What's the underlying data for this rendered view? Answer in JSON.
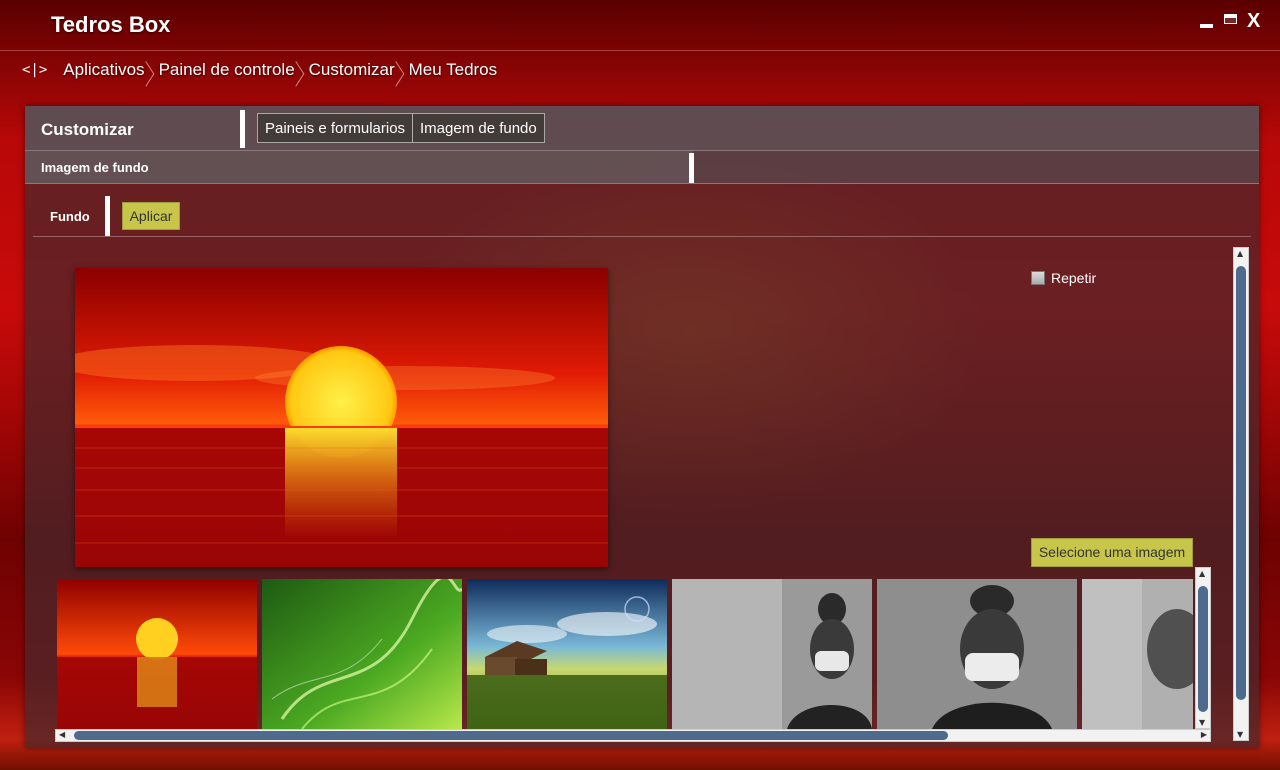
{
  "window": {
    "title": "Tedros Box",
    "controls": {
      "minimize_icon": "minimize-icon",
      "maximize_icon": "maximize-icon",
      "close_label": "X"
    }
  },
  "breadcrumb": {
    "back_label": "<|>",
    "items": [
      "Aplicativos",
      "Painel de controle",
      "Customizar",
      "Meu Tedros"
    ]
  },
  "panel": {
    "title": "Customizar",
    "tabs": [
      "Paineis e formularios",
      "Imagem de fundo"
    ],
    "subtitle": "Imagem de fundo"
  },
  "form": {
    "section_label": "Fundo",
    "apply_label": "Aplicar",
    "repeat_label": "Repetir",
    "repeat_checked": false,
    "select_image_label": "Selecione uma imagem"
  },
  "thumbnails": [
    {
      "name": "sunset-sea-thumbnail"
    },
    {
      "name": "green-abstract-thumbnail"
    },
    {
      "name": "house-field-thumbnail"
    },
    {
      "name": "masked-girl-thumbnail-1"
    },
    {
      "name": "masked-girl-thumbnail-2"
    },
    {
      "name": "masked-girl-thumbnail-3"
    }
  ],
  "colors": {
    "accent_button": "#c8c64a",
    "scrollbar_thumb": "#4e6a8c",
    "background_red": "#c80a0a"
  }
}
